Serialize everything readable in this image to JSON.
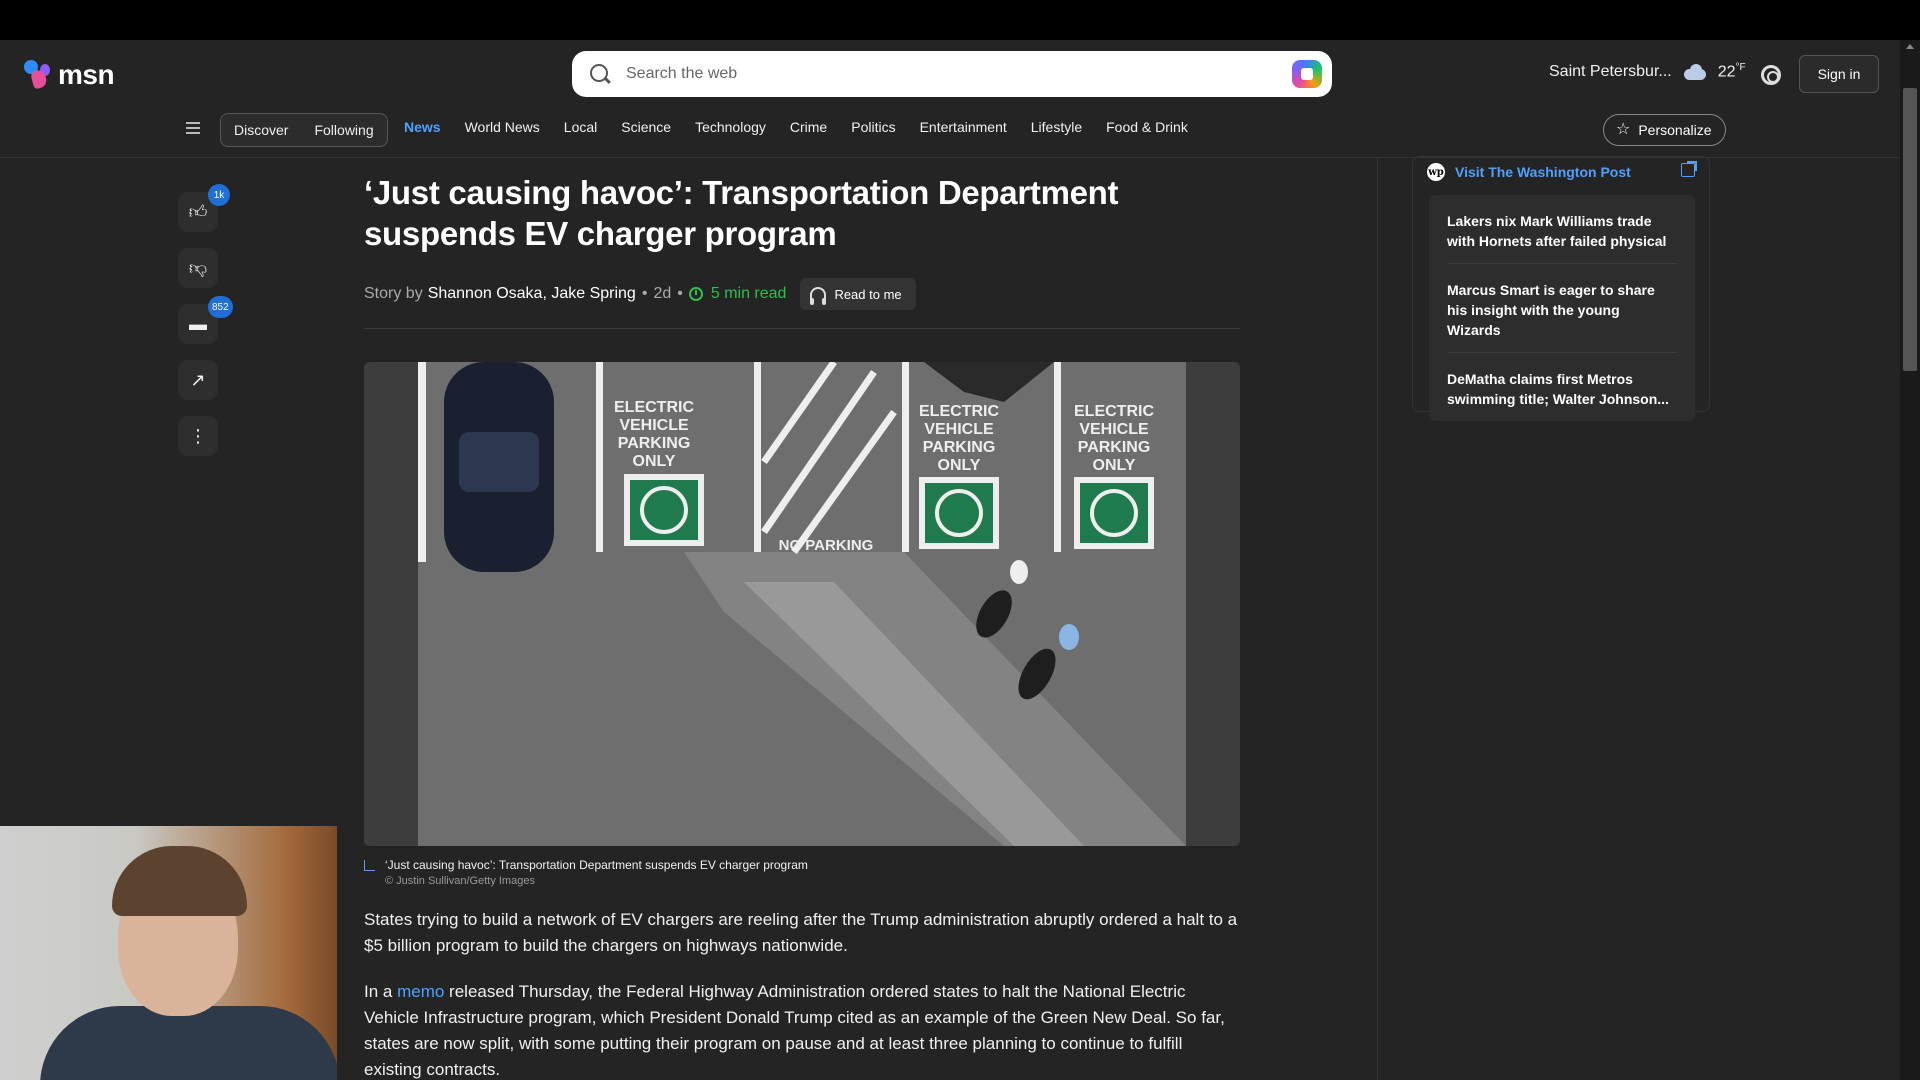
{
  "header": {
    "logo_text": "msn",
    "search_placeholder": "Search the web",
    "location": "Saint Petersbur...",
    "temperature": "22",
    "temp_unit": "°F",
    "signin_label": "Sign in",
    "personalize_label": "Personalize"
  },
  "feed_toggle": [
    "Discover",
    "Following"
  ],
  "nav": [
    "News",
    "World News",
    "Local",
    "Science",
    "Technology",
    "Crime",
    "Politics",
    "Entertainment",
    "Lifestyle",
    "Food & Drink"
  ],
  "nav_active": "News",
  "rail": {
    "like_count": "1k",
    "comment_count": "852"
  },
  "article": {
    "headline": "‘Just causing havoc’: Transportation Department suspends EV charger program",
    "story_by": "Story by",
    "authors": "Shannon Osaka, Jake Spring",
    "age": "2d",
    "read_time": "5 min read",
    "read_to_me": "Read to me",
    "image": {
      "signs": [
        "ELECTRIC VEHICLE PARKING ONLY",
        "ELECTRIC VEHICLE PARKING ONLY",
        "ELECTRIC VEHICLE PARKING ONLY"
      ],
      "no_parking": "NO PARKING"
    },
    "caption_title": "‘Just causing havoc’: Transportation Department suspends EV charger program",
    "caption_credit": "© Justin Sullivan/Getty Images",
    "para1": "States trying to build a network of EV chargers are reeling after the Trump administration abruptly ordered a halt to a $5 billion program to build the chargers on highways nationwide.",
    "para2_pre": "In a ",
    "para2_link": "memo",
    "para2_post": " released Thursday, the Federal Highway Administration ordered states to halt the National Electric Vehicle Infrastructure program, which President Donald Trump cited as an example of the Green New Deal. So far, states are now split, with some putting their program on pause and at least three planning to continue to fulfill existing contracts."
  },
  "sidebar": {
    "source_label": "Visit The Washington Post",
    "source_logo": "wp",
    "items": [
      "Lakers nix Mark Williams trade with Hornets after failed physical",
      "Marcus Smart is eager to share his insight with the young Wizards",
      "DeMatha claims first Metros swimming title; Walter Johnson..."
    ]
  },
  "colors": {
    "background": "#242424",
    "accent": "#4ea1ff",
    "green": "#2fbf4a",
    "badge": "#1f6fd6"
  }
}
